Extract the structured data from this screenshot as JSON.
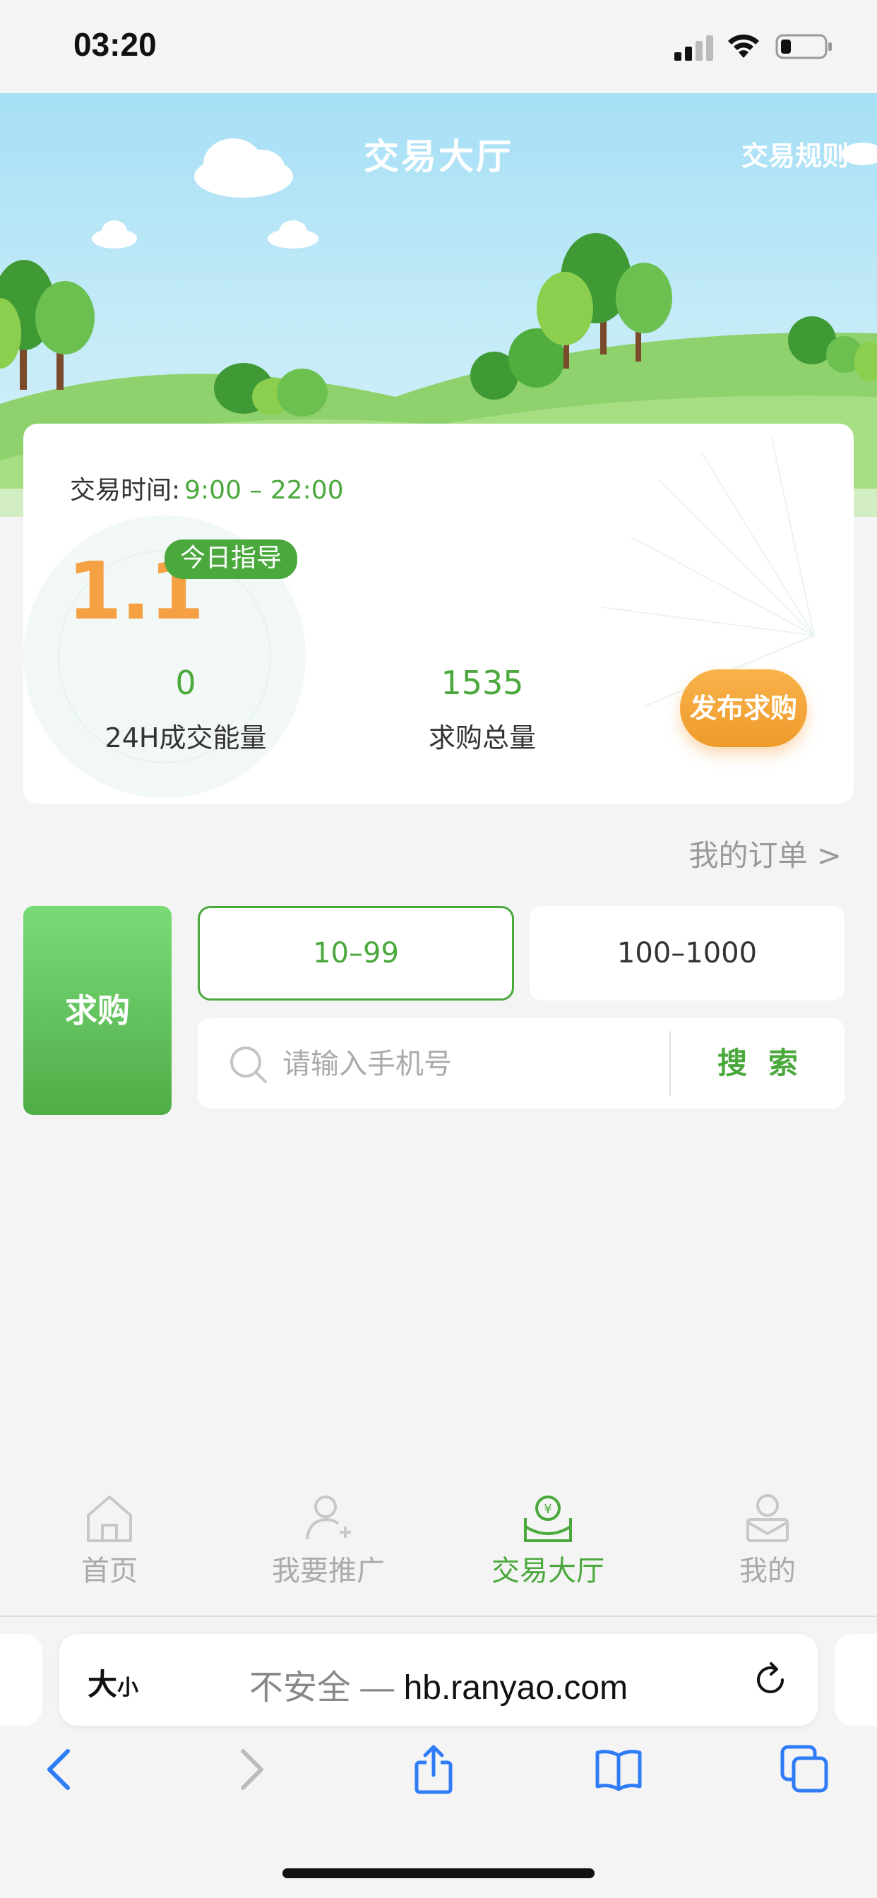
{
  "status_bar": {
    "time": "03:20"
  },
  "header": {
    "title": "交易大厅",
    "rules_link": "交易规则"
  },
  "card": {
    "trade_time_label": "交易时间:",
    "trade_time_value": "9:00 – 22:00",
    "guide_price": "1.1",
    "guide_badge": "今日指导",
    "stats": [
      {
        "value": "0",
        "label": "24H成交能量"
      },
      {
        "value": "1535",
        "label": "求购总量"
      }
    ],
    "publish_button": "发布求购"
  },
  "my_orders": "我的订单 >",
  "buy_panel": {
    "buy_label": "求购",
    "ranges": [
      "10–99",
      "100–1000"
    ],
    "active_range_index": 0,
    "search_placeholder": "请输入手机号",
    "search_button": "搜索"
  },
  "tabbar": {
    "active_index": 2,
    "items": [
      {
        "label": "首页",
        "icon": "home-icon"
      },
      {
        "label": "我要推广",
        "icon": "user-add-icon"
      },
      {
        "label": "交易大厅",
        "icon": "yuan-bag-icon"
      },
      {
        "label": "我的",
        "icon": "profile-icon"
      }
    ]
  },
  "browser": {
    "text_size": "大",
    "text_size_small": "小",
    "insecure_label": "不安全 — ",
    "domain": "hb.ranyao.com"
  },
  "colors": {
    "accent_green": "#4aa83c",
    "orange": "#f5a043"
  }
}
